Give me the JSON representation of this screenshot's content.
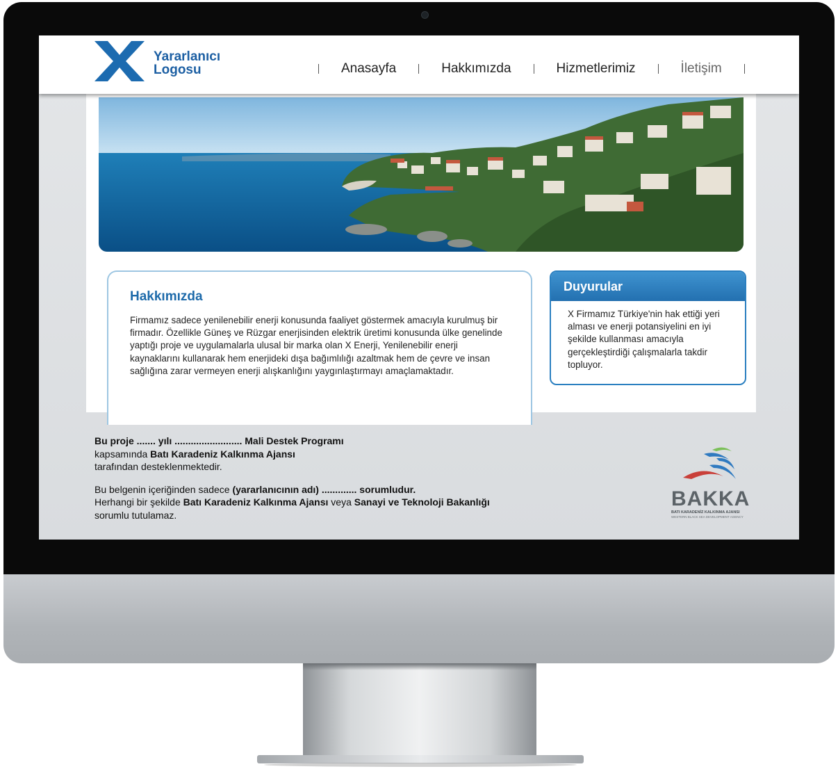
{
  "header": {
    "logo_line1": "Yararlanıcı",
    "logo_line2": "Logosu",
    "nav": [
      "Anasayfa",
      "Hakkımızda",
      "Hizmetlerimiz",
      "İletişim"
    ]
  },
  "about": {
    "title": "Hakkımızda",
    "body": "Firmamız sadece yenilenebilir enerji konusunda faaliyet göstermek amacıyla kurulmuş bir firmadır. Özellikle Güneş ve Rüzgar enerjisinden elektrik üretimi konusunda ülke genelinde yaptığı proje ve uygulamalarla ulusal bir marka olan X Enerji, Yenilenebilir enerji kaynaklarını kullanarak hem enerjideki dışa bağımlılığı azaltmak hem de çevre ve insan sağlığına zarar vermeyen enerji alışkanlığını yaygınlaştırmayı amaçlamaktadır."
  },
  "news": {
    "title": "Duyurular",
    "body": "X Firmamız Türkiye'nin hak ettiği yeri alması ve enerji potansiyelini en iyi şekilde kullanması amacıyla gerçekleştirdiği çalışmalarla takdir topluyor."
  },
  "footer": {
    "p1_bold1": "Bu proje ....... yılı ......................... Mali Destek Programı",
    "p1_text1": "kapsamında ",
    "p1_bold2": "Batı Karadeniz Kalkınma Ajansı",
    "p1_text2": "tarafından desteklenmektedir.",
    "p2_text1": "Bu belgenin içeriğinden sadece ",
    "p2_bold1": "(yararlanıcının adı) ............. sorumludur.",
    "p2_text2": "Herhangi bir şekilde ",
    "p2_bold2": "Batı Karadeniz Kalkınma Ajansı",
    "p2_text3": " veya ",
    "p2_bold3": "Sanayi ve Teknoloji Bakanlığı",
    "p2_text4": "  sorumlu tutulamaz."
  },
  "bakka": {
    "word": "BAKKA",
    "sub1": "BATI KARADENİZ KALKINMA AJANSI",
    "sub2": "WESTERN BLACK SEA DEVELOPMENT AGENCY"
  },
  "colors": {
    "brand_blue": "#1c5fa3",
    "heading_blue": "#1d6aaa",
    "news_header": "#2a7fc0"
  }
}
